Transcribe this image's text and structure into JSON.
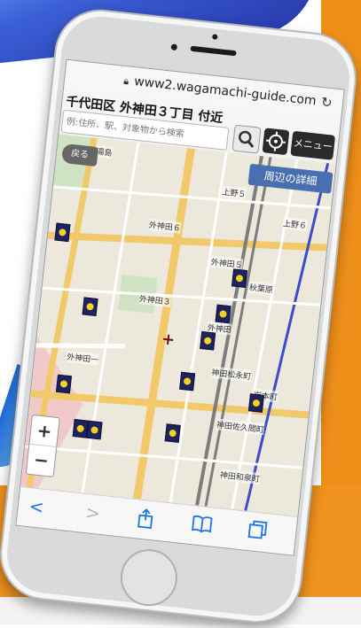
{
  "browser": {
    "url": "www2.wagamachi-guide.com",
    "lock_icon": "lock-icon",
    "reload_icon": "reload-icon"
  },
  "page": {
    "location_title": "千代田区 外神田３丁目 付近",
    "search_placeholder": "例:住所、駅、対象物から検索",
    "menu_label": "メニュー",
    "back_label": "戻る",
    "detail_label": "周辺の詳細"
  },
  "map": {
    "labels": [
      "湯島",
      "外神田６",
      "外神田５",
      "外神田３",
      "外神田一",
      "外神田",
      "神田佐久間町",
      "神田和泉町",
      "神田松永町",
      "秋葉原",
      "上野５",
      "上野６",
      "岩本町"
    ],
    "zoom_in": "+",
    "zoom_out": "−",
    "crosshair": "+"
  },
  "toolbar": {
    "back": "<",
    "forward": ">",
    "share": "share-icon",
    "bookmarks": "book-icon",
    "tabs": "tabs-icon"
  },
  "colors": {
    "accent_orange": "#f0921e",
    "button_dark": "#2a2a2a",
    "detail_blue": "#4a6fb0",
    "ios_blue": "#1a73e8"
  }
}
